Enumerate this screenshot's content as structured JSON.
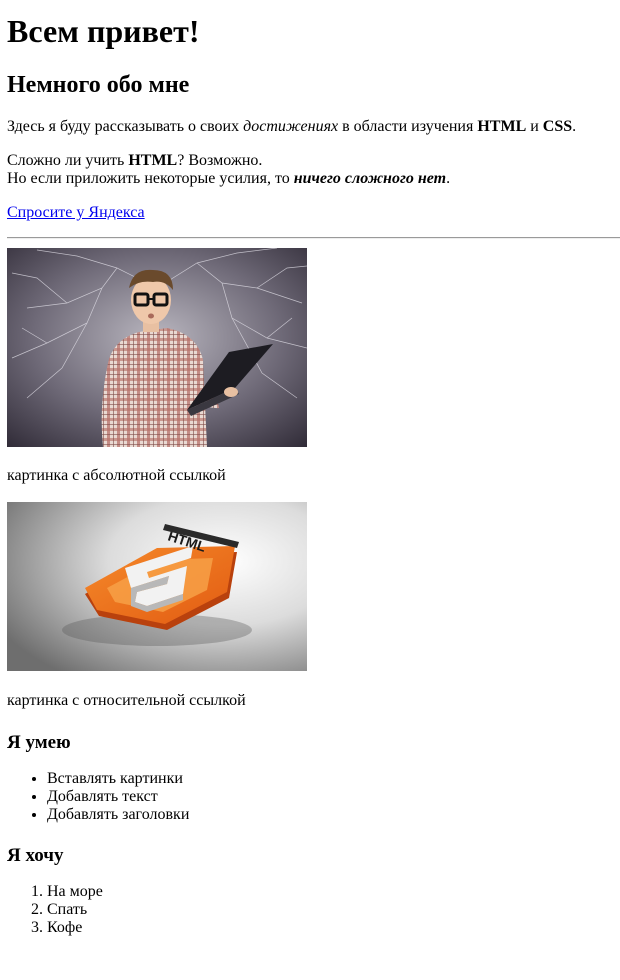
{
  "header": {
    "title": "Всем привет!"
  },
  "about": {
    "heading": "Немного обо мне",
    "p1": {
      "before": "Здесь я буду рассказывать о своих ",
      "em": "достижениях",
      "middle": " в области изучения ",
      "strong1": "HTML",
      "and": " и ",
      "strong2": "CSS",
      "end": "."
    },
    "p2": {
      "line1_before": "Сложно ли учить ",
      "line1_strong": "HTML",
      "line1_after": "? Возможно.",
      "line2_before": "Но если приложить некоторые усилия, то ",
      "line2_strong_em": "ничего сложного нет",
      "line2_end": "."
    },
    "link_text": "Спросите у Яндекса"
  },
  "images": {
    "photo_icon": "person-with-laptop-photo",
    "caption1": "картинка с абсолютной ссылкой",
    "logo_icon": "html5-logo-3d",
    "logo_text": "HTML",
    "caption2": "картинка с относительной ссылкой"
  },
  "skills": {
    "heading": "Я умею",
    "items": [
      "Вставлять картинки",
      "Добавлять текст",
      "Добавлять заголовки"
    ]
  },
  "wants": {
    "heading": "Я хочу",
    "items": [
      "На море",
      "Спать",
      "Кофе"
    ]
  },
  "colors": {
    "link": "#0000ee",
    "html5_orange": "#e8651c",
    "html5_dark": "#c34a10"
  }
}
